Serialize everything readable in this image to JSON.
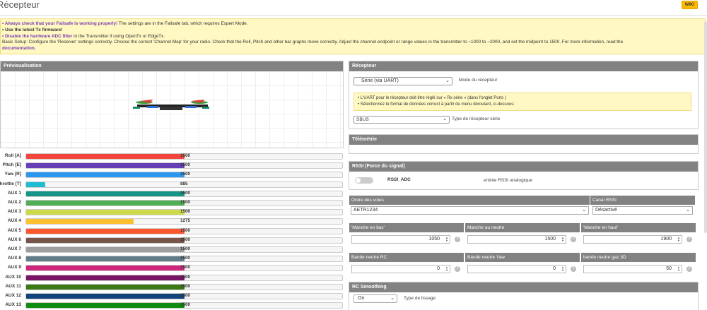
{
  "header": {
    "title": "Récepteur",
    "wiki_label": "WIKI"
  },
  "note": {
    "line1_bold": "• Always check that your Failsafe is working properly!",
    "line1_rest": " The settings are in the Failsafe tab, which requires Expert Mode.",
    "line2": "• Use the latest Tx firmware!",
    "line3_bold": "• Disable the hardware ADC filter",
    "line3_rest": " in the Transmitter if using OpenTx or EdgeTx.",
    "line4": "Basic Setup: Configure the 'Receiver' settings correctly. Choose the correct 'Channel Map' for your radio. Check that the Roll, Pitch and other bar graphs move correctly. Adjust the channel endpoint or range values in the transmitter to ~1000 to ~2000, and set the midpoint to 1500. For more information, read the",
    "line5": "documentation."
  },
  "preview": {
    "title": "Prévisualisation"
  },
  "channels": [
    {
      "label": "Roll [A]",
      "value": "1500",
      "fraction": 0.5,
      "color": "#f1453d"
    },
    {
      "label": "Pitch [E]",
      "value": "1500",
      "fraction": 0.5,
      "color": "#673fb4"
    },
    {
      "label": "Yaw [R]",
      "value": "1500",
      "fraction": 0.5,
      "color": "#2b98f0"
    },
    {
      "label": "Throttle [T]",
      "value": "885",
      "fraction": 0.06,
      "color": "#1fbcd2"
    },
    {
      "label": "AUX 1",
      "value": "1500",
      "fraction": 0.5,
      "color": "#159588"
    },
    {
      "label": "AUX 2",
      "value": "1500",
      "fraction": 0.5,
      "color": "#50ae55"
    },
    {
      "label": "AUX 3",
      "value": "1500",
      "fraction": 0.5,
      "color": "#cdda49"
    },
    {
      "label": "AUX 4",
      "value": "1275",
      "fraction": 0.34,
      "color": "#fdc02f"
    },
    {
      "label": "AUX 5",
      "value": "1500",
      "fraction": 0.5,
      "color": "#fc5830"
    },
    {
      "label": "AUX 6",
      "value": "1500",
      "fraction": 0.5,
      "color": "#785549"
    },
    {
      "label": "AUX 7",
      "value": "1500",
      "fraction": 0.5,
      "color": "#9e9e9e"
    },
    {
      "label": "AUX 8",
      "value": "1500",
      "fraction": 0.5,
      "color": "#617d8a"
    },
    {
      "label": "AUX 9",
      "value": "1500",
      "fraction": 0.5,
      "color": "#cf267d"
    },
    {
      "label": "AUX 10",
      "value": "1500",
      "fraction": 0.5,
      "color": "#7a1464"
    },
    {
      "label": "AUX 11",
      "value": "1500",
      "fraction": 0.5,
      "color": "#3a7a14"
    },
    {
      "label": "AUX 12",
      "value": "1500",
      "fraction": 0.5,
      "color": "#14427a"
    },
    {
      "label": "AUX 13",
      "value": "1500",
      "fraction": 0.5,
      "color": "#0f8b0f"
    }
  ],
  "receiver": {
    "title": "Récepteur",
    "mode_value": "Série (via UART)",
    "mode_label": "Mode du récepteur",
    "hint1": "• L'UART pour le récepteur doit être réglé sur « Rx série » (dans l'onglet Ports )",
    "hint2": "• Sélectionnez le format de données correct à partir du menu déroulant, ci-dessous:",
    "serial_value": "SBUS",
    "serial_label": "Type de récepteur série"
  },
  "telemetry": {
    "title": "Télémétrie"
  },
  "rssi": {
    "title": "RSSI (Force du signal)",
    "toggle_label": "RSSI_ADC",
    "toggle_desc": "entrée RSSI analogique"
  },
  "channel_map": {
    "head_left": "Ordre des voies",
    "head_right": "Canal RSSI",
    "map_value": "AETR1234",
    "rssi_value": "Désactivé"
  },
  "sticks": {
    "low_label": "'Manche en bas'",
    "center_label": "Manche au neutre",
    "high_label": "'Manche en haut'",
    "low_value": "1050",
    "center_value": "1500",
    "high_value": "1900"
  },
  "deadband": {
    "rc_label": "Bande neutre RC",
    "yaw_label": "Bande neutre Yaw",
    "throttle_label": "bande neutre gaz 3D",
    "rc_value": "0",
    "yaw_value": "0",
    "throttle_value": "50"
  },
  "smoothing": {
    "title": "RC Smoothing",
    "value": "On",
    "label": "Type de lissage"
  }
}
